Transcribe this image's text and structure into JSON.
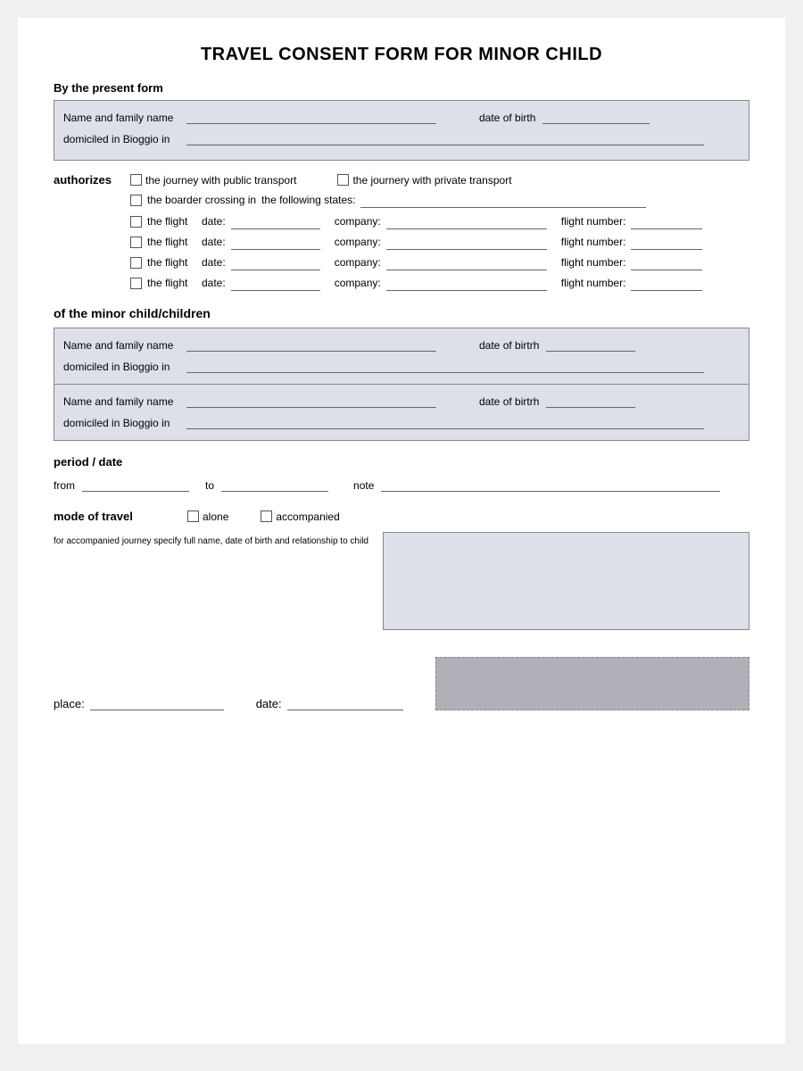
{
  "title": "TRAVEL CONSENT FORM FOR MINOR CHILD",
  "by_present_form": "By the present form",
  "parent": {
    "name_label": "Name and family name",
    "dob_label": "date of birth",
    "domicile_label": "domiciled in Bioggio in"
  },
  "authorizes": {
    "label": "authorizes",
    "options": [
      {
        "id": "public_transport",
        "label": "the journey with public transport"
      },
      {
        "id": "private_transport",
        "label": "the journery with private transport"
      }
    ],
    "border_crossing": {
      "checkbox_label": "the boarder crossing in",
      "following_states_label": "the following states:"
    },
    "flights": [
      {
        "label": "the flight",
        "date_label": "date:",
        "company_label": "company:",
        "flightnum_label": "flight number:"
      },
      {
        "label": "the flight",
        "date_label": "date:",
        "company_label": "company:",
        "flightnum_label": "flight number:"
      },
      {
        "label": "the flight",
        "date_label": "date:",
        "company_label": "company:",
        "flightnum_label": "flight number:"
      },
      {
        "label": "the flight",
        "date_label": "date:",
        "company_label": "company:",
        "flightnum_label": "flight number:"
      }
    ]
  },
  "minor_child": {
    "label": "of the minor child/children",
    "children": [
      {
        "name_label": "Name and family name",
        "dob_label": "date of birtrh",
        "domicile_label": "domiciled in Bioggio in"
      },
      {
        "name_label": "Name and family name",
        "dob_label": "date of birtrh",
        "domicile_label": "domiciled in Bioggio in"
      }
    ]
  },
  "period": {
    "label": "period / date",
    "from_label": "from",
    "to_label": "to",
    "note_label": "note"
  },
  "mode_of_travel": {
    "label": "mode of travel",
    "alone_label": "alone",
    "accompanied_label": "accompanied",
    "note_label": "for accompanied journey specify full name, date of birth and relationship to child"
  },
  "bottom": {
    "place_label": "place:",
    "date_label": "date:"
  }
}
